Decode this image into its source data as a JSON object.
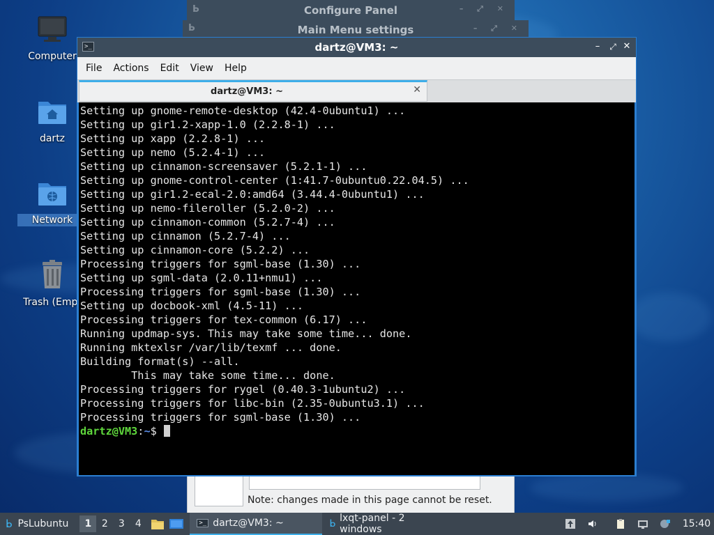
{
  "desktop": {
    "icons": [
      {
        "label": "Computer",
        "icon": "monitor-icon"
      },
      {
        "label": "dartz",
        "icon": "home-folder-icon"
      },
      {
        "label": "Network",
        "icon": "network-folder-icon"
      },
      {
        "label": "Trash (Empt",
        "icon": "trash-icon"
      }
    ]
  },
  "background_windows": {
    "configure_panel_title": "Configure Panel",
    "main_menu_settings_title": "Main Menu settings",
    "note": "Note: changes made in this page cannot be reset."
  },
  "terminal": {
    "title": "dartz@VM3: ~",
    "menu": [
      "File",
      "Actions",
      "Edit",
      "View",
      "Help"
    ],
    "tab_label": "dartz@VM3: ~",
    "lines": [
      "Setting up gnome-remote-desktop (42.4-0ubuntu1) ...",
      "Setting up gir1.2-xapp-1.0 (2.2.8-1) ...",
      "Setting up xapp (2.2.8-1) ...",
      "Setting up nemo (5.2.4-1) ...",
      "Setting up cinnamon-screensaver (5.2.1-1) ...",
      "Setting up gnome-control-center (1:41.7-0ubuntu0.22.04.5) ...",
      "Setting up gir1.2-ecal-2.0:amd64 (3.44.4-0ubuntu1) ...",
      "Setting up nemo-fileroller (5.2.0-2) ...",
      "Setting up cinnamon-common (5.2.7-4) ...",
      "Setting up cinnamon (5.2.7-4) ...",
      "Setting up cinnamon-core (5.2.2) ...",
      "Processing triggers for sgml-base (1.30) ...",
      "Setting up sgml-data (2.0.11+nmu1) ...",
      "Processing triggers for sgml-base (1.30) ...",
      "Setting up docbook-xml (4.5-11) ...",
      "Processing triggers for tex-common (6.17) ...",
      "Running updmap-sys. This may take some time... done.",
      "Running mktexlsr /var/lib/texmf ... done.",
      "Building format(s) --all.",
      "        This may take some time... done.",
      "Processing triggers for rygel (0.40.3-1ubuntu2) ...",
      "Processing triggers for libc-bin (2.35-0ubuntu3.1) ...",
      "Processing triggers for sgml-base (1.30) ..."
    ],
    "prompt_user": "dartz@VM3",
    "prompt_sep": ":",
    "prompt_path": "~",
    "prompt_symbol": "$ "
  },
  "taskbar": {
    "start_label": "PsLubuntu",
    "desktops": [
      "1",
      "2",
      "3",
      "4"
    ],
    "active_desktop": "1",
    "tasks": [
      {
        "label": "dartz@VM3: ~",
        "icon": "terminal-icon",
        "active": true
      },
      {
        "label": "lxqt-panel - 2 windows",
        "icon": "lxqt-icon",
        "active": false
      }
    ],
    "clock": "15:40"
  }
}
